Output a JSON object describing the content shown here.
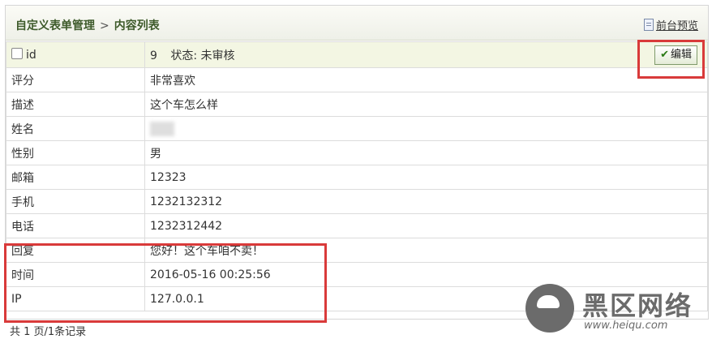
{
  "header": {
    "crumb1": "自定义表单管理",
    "crumb_sep": ">",
    "crumb2": "内容列表",
    "preview": "前台预览"
  },
  "record": {
    "id_label": "id",
    "id_value": "9",
    "status_label": "状态:",
    "status_value": "未审核",
    "edit_label": "编辑"
  },
  "rows": [
    {
      "label": "评分",
      "value": "非常喜欢"
    },
    {
      "label": "描述",
      "value": "这个车怎么样"
    },
    {
      "label": "姓名",
      "value": ""
    },
    {
      "label": "性别",
      "value": "男"
    },
    {
      "label": "邮箱",
      "value": "12323"
    },
    {
      "label": "手机",
      "value": "1232132312"
    },
    {
      "label": "电话",
      "value": "1232312442"
    },
    {
      "label": "回复",
      "value": "您好！这个车咱不卖！"
    },
    {
      "label": "时间",
      "value": "2016-05-16 00:25:56"
    },
    {
      "label": "IP",
      "value": "127.0.0.1"
    }
  ],
  "footer": {
    "pagination": "共 1 页/1条记录"
  },
  "watermark": {
    "title": "黑区网络",
    "url": "www.heiqu.com"
  },
  "colors": {
    "highlight": "#d93a3a",
    "header_text": "#3d5a2a"
  }
}
